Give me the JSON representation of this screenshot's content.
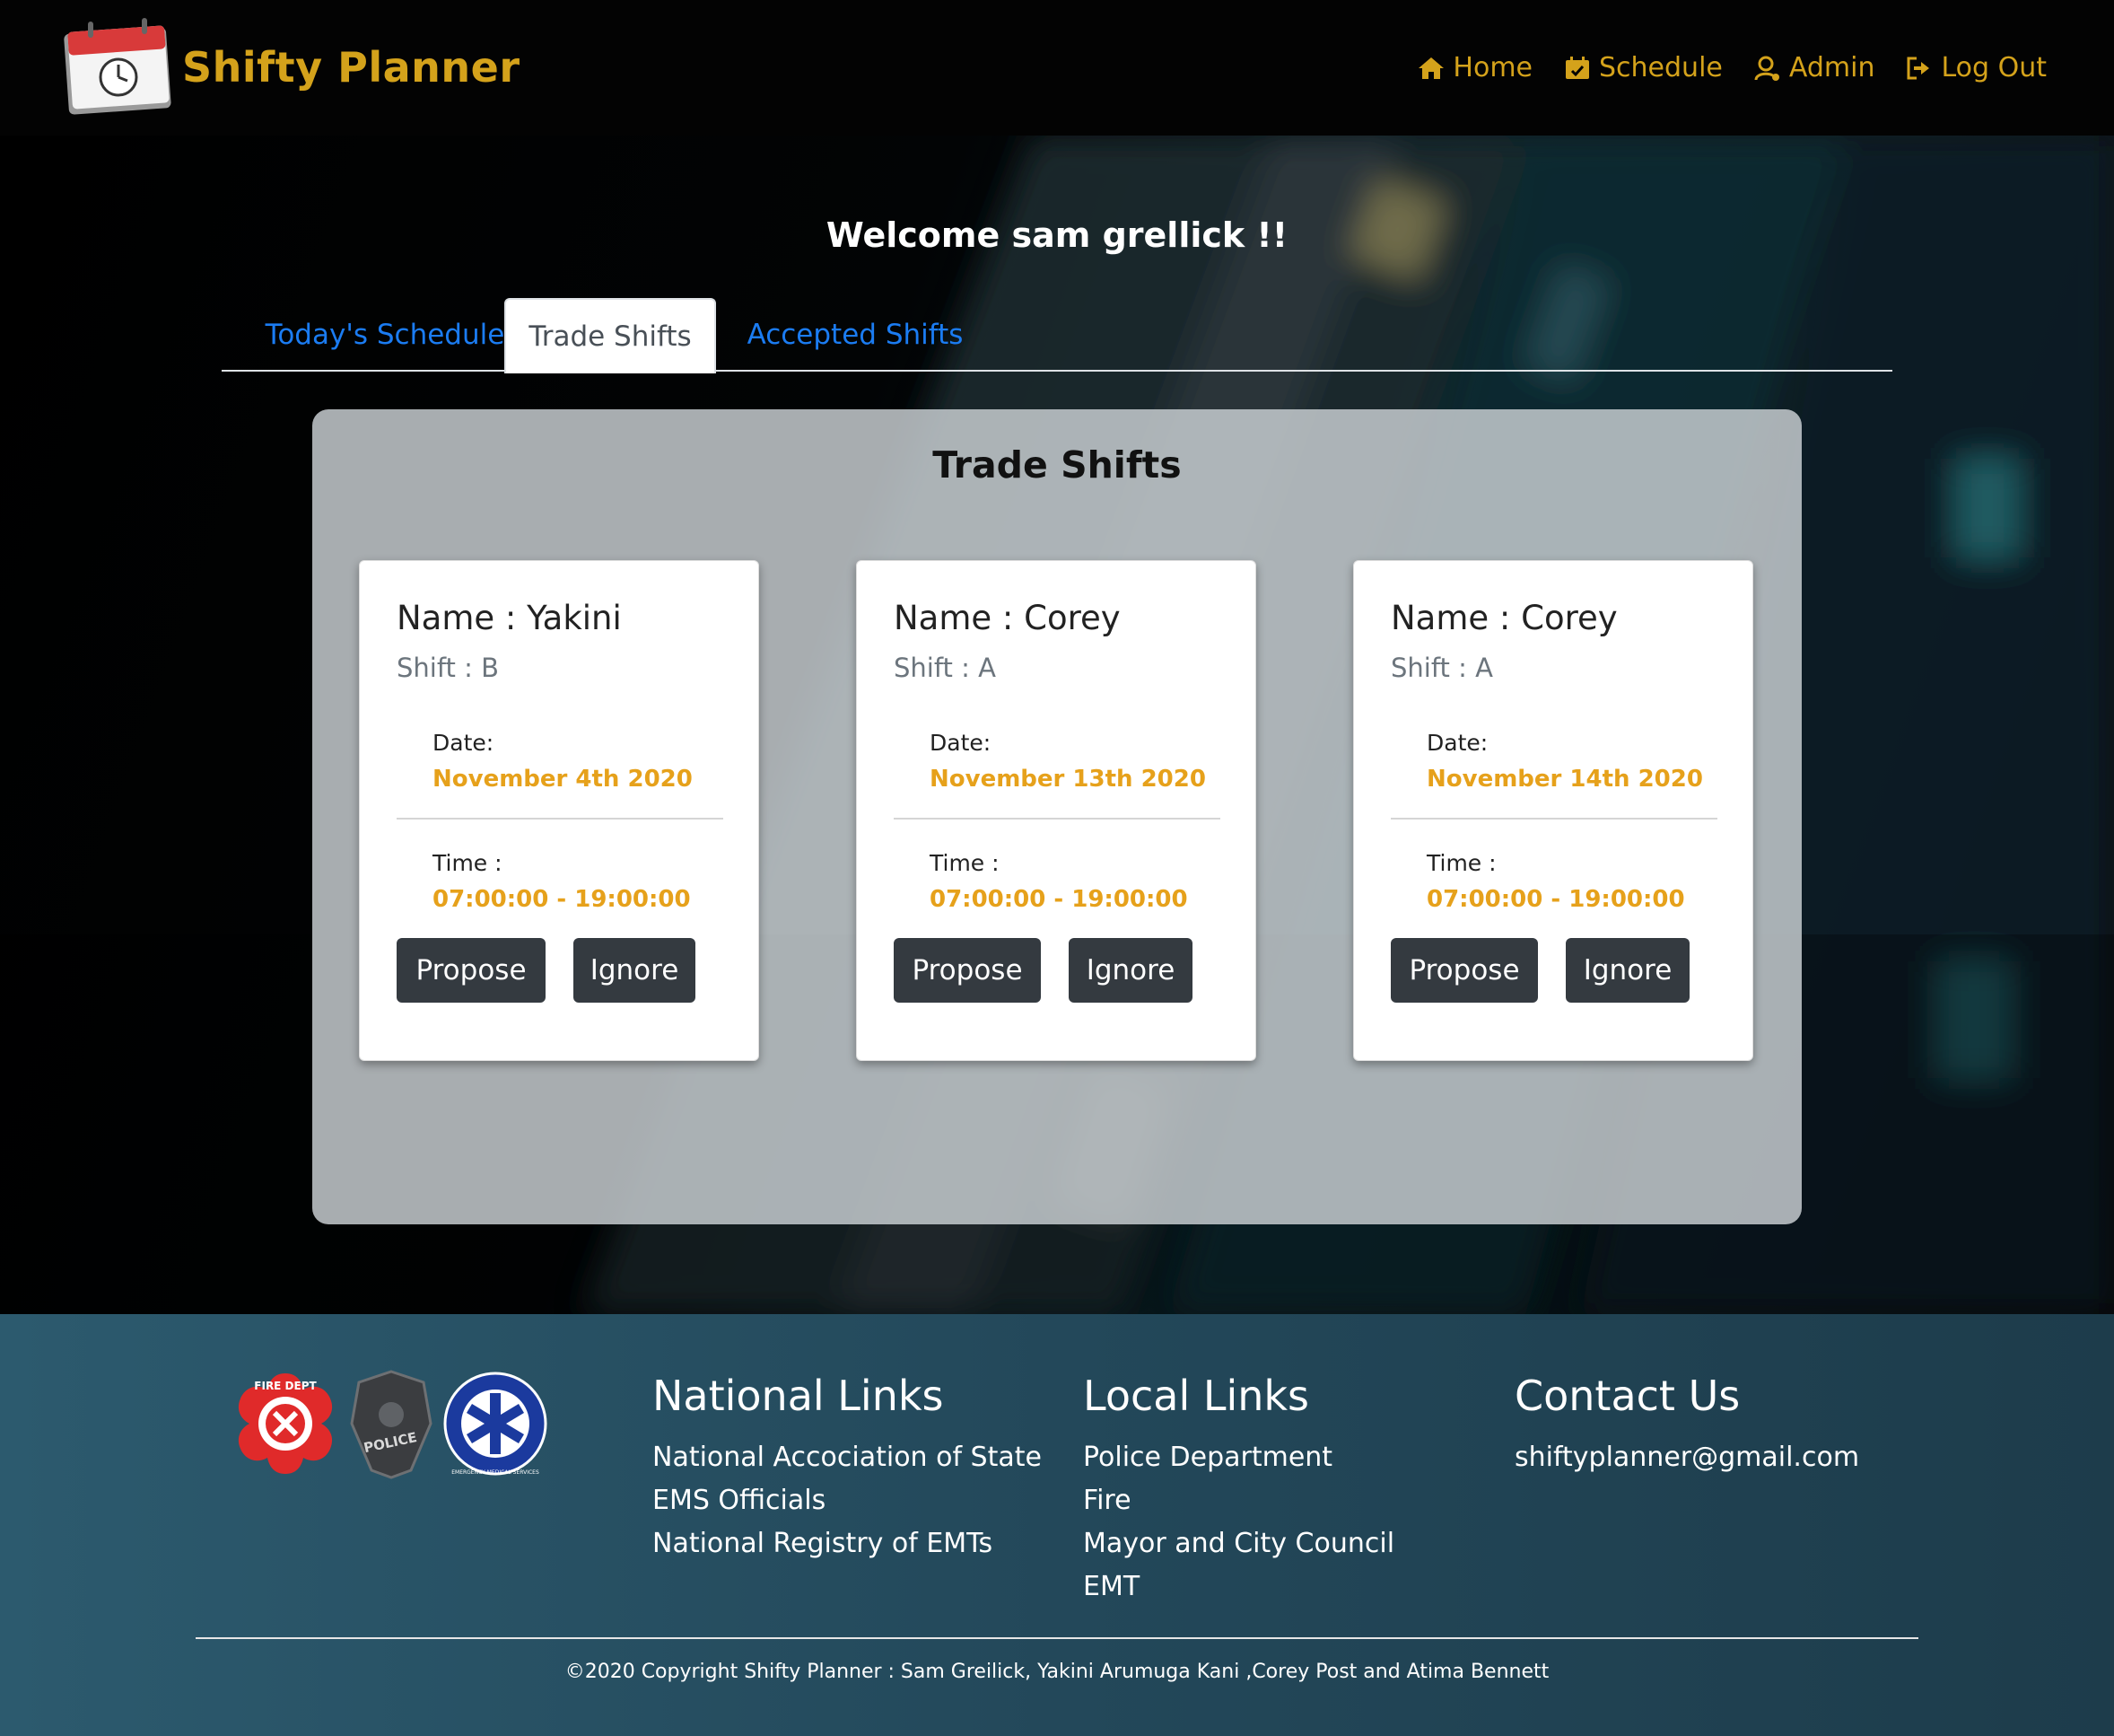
{
  "nav": {
    "brand": "Shifty Planner",
    "links": [
      {
        "label": "Home",
        "icon": "home-icon"
      },
      {
        "label": "Schedule",
        "icon": "calendar-icon"
      },
      {
        "label": "Admin",
        "icon": "user-icon"
      },
      {
        "label": "Log Out",
        "icon": "logout-icon"
      }
    ]
  },
  "welcome": "Welcome sam grellick !!",
  "tabs": [
    {
      "label": "Today's Schedule",
      "active": false
    },
    {
      "label": "Trade Shifts",
      "active": true
    },
    {
      "label": "Accepted Shifts",
      "active": false
    }
  ],
  "panel": {
    "title": "Trade Shifts",
    "cards": [
      {
        "name": "Name : Yakini",
        "shift": "Shift : B",
        "date_label": "Date:",
        "date": "November 4th 2020",
        "time_label": "Time :",
        "time": "07:00:00 - 19:00:00",
        "propose": "Propose",
        "ignore": "Ignore"
      },
      {
        "name": "Name : Corey",
        "shift": "Shift : A",
        "date_label": "Date:",
        "date": "November 13th 2020",
        "time_label": "Time :",
        "time": "07:00:00 - 19:00:00",
        "propose": "Propose",
        "ignore": "Ignore"
      },
      {
        "name": "Name : Corey",
        "shift": "Shift : A",
        "date_label": "Date:",
        "date": "November 14th 2020",
        "time_label": "Time :",
        "time": "07:00:00 - 19:00:00",
        "propose": "Propose",
        "ignore": "Ignore"
      }
    ]
  },
  "footer": {
    "badge_texts": [
      "FIRE DEPT",
      "POLICE",
      "EMERGENCY MEDICAL SERVICES"
    ],
    "national": {
      "heading": "National Links",
      "links": [
        "National Accociation of State",
        "EMS Officials",
        "National Registry of EMTs"
      ]
    },
    "local": {
      "heading": "Local Links",
      "links": [
        "Police Department",
        "Fire",
        "Mayor and City Council",
        "EMT"
      ]
    },
    "contact": {
      "heading": "Contact Us",
      "email": "shiftyplanner@gmail.com"
    },
    "copyright": "©2020 Copyright Shifty Planner : Sam Greilick, Yakini Arumuga Kani ,Corey Post and Atima Bennett"
  },
  "colors": {
    "accent": "#d4a21b",
    "tab_link": "#1b7cf2",
    "button": "#343a40",
    "value": "#e6a11b"
  }
}
